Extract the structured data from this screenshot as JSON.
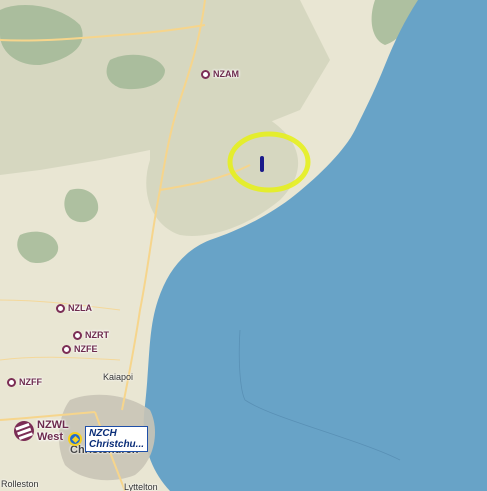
{
  "map": {
    "colors": {
      "sea": "#68a3c7",
      "land": "#e9e6d3",
      "hills": "#d6d7c0",
      "forest": "#9fb693",
      "highway": "#f6d58c",
      "urban": "#c9c4b6",
      "highlight": "#e6ef1e",
      "marker": "#1a1a8a",
      "airport": "#7b2d55",
      "primary_airport": "#1f6bd1"
    },
    "airports": [
      {
        "code": "NZAM"
      },
      {
        "code": "NZLA"
      },
      {
        "code": "NZRT"
      },
      {
        "code": "NZFE"
      },
      {
        "code": "NZFF"
      }
    ],
    "major_airfields": {
      "nzwl": {
        "code": "NZWL",
        "name": "West"
      },
      "nzch": {
        "code": "NZCH",
        "name": "Christchu..."
      }
    },
    "towns": {
      "kaiapoi": "Kaiapoi",
      "christchurch": "Christchurch",
      "rolleston": "Rolleston",
      "lyttelton": "Lyttelton"
    },
    "highlight_icon": "circle-highlight",
    "marker_icon": "aircraft-position-marker"
  }
}
